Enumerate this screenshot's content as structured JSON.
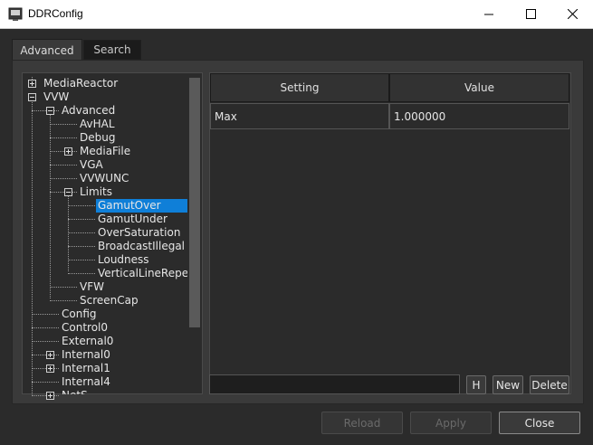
{
  "window": {
    "title": "DDRConfig"
  },
  "tabs": [
    {
      "label": "Advanced",
      "active": true
    },
    {
      "label": "Search",
      "active": false
    }
  ],
  "tree": {
    "selected": "GamutOver",
    "items": [
      {
        "label": "MediaReactor",
        "level": 0,
        "expander": "plus"
      },
      {
        "label": "VVW",
        "level": 0,
        "expander": "minus"
      },
      {
        "label": "Advanced",
        "level": 1,
        "expander": "minus"
      },
      {
        "label": "AvHAL",
        "level": 2,
        "expander": "none"
      },
      {
        "label": "Debug",
        "level": 2,
        "expander": "none"
      },
      {
        "label": "MediaFile",
        "level": 2,
        "expander": "plus"
      },
      {
        "label": "VGA",
        "level": 2,
        "expander": "none"
      },
      {
        "label": "VVWUNC",
        "level": 2,
        "expander": "none"
      },
      {
        "label": "Limits",
        "level": 2,
        "expander": "minus"
      },
      {
        "label": "GamutOver",
        "level": 3,
        "expander": "none"
      },
      {
        "label": "GamutUnder",
        "level": 3,
        "expander": "none"
      },
      {
        "label": "OverSaturation",
        "level": 3,
        "expander": "none"
      },
      {
        "label": "BroadcastIllegal",
        "level": 3,
        "expander": "none"
      },
      {
        "label": "Loudness",
        "level": 3,
        "expander": "none"
      },
      {
        "label": "VerticalLineRepe...",
        "level": 3,
        "expander": "none"
      },
      {
        "label": "VFW",
        "level": 2,
        "expander": "none"
      },
      {
        "label": "ScreenCap",
        "level": 2,
        "expander": "none"
      },
      {
        "label": "Config",
        "level": 1,
        "expander": "none"
      },
      {
        "label": "Control0",
        "level": 1,
        "expander": "none"
      },
      {
        "label": "External0",
        "level": 1,
        "expander": "none"
      },
      {
        "label": "Internal0",
        "level": 1,
        "expander": "plus"
      },
      {
        "label": "Internal1",
        "level": 1,
        "expander": "plus"
      },
      {
        "label": "Internal4",
        "level": 1,
        "expander": "none"
      },
      {
        "label": "NetS...",
        "level": 1,
        "expander": "plus"
      }
    ]
  },
  "table": {
    "columns": [
      "Setting",
      "Value"
    ],
    "rows": [
      {
        "setting": "Max",
        "value": "1.000000"
      }
    ]
  },
  "edit": {
    "value": ""
  },
  "buttons": {
    "h": "H",
    "new": "New",
    "delete": "Delete",
    "reload": "Reload",
    "apply": "Apply",
    "close": "Close"
  },
  "colors": {
    "selection": "#0f7fd8",
    "background": "#2b2b2b"
  },
  "icons": [
    "app-icon",
    "minimize-icon",
    "maximize-icon",
    "close-icon",
    "expand-icon",
    "collapse-icon"
  ]
}
